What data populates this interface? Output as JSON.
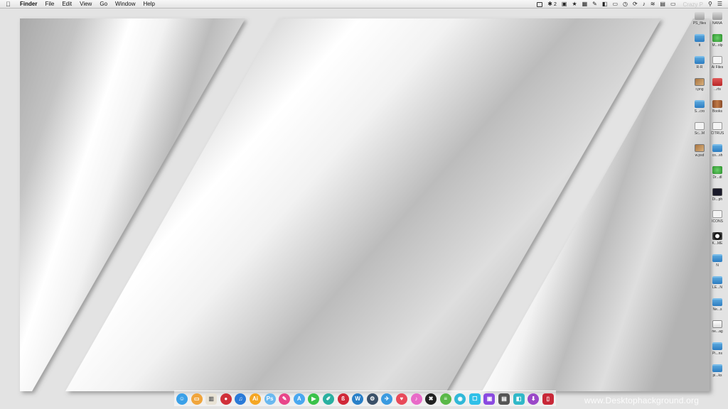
{
  "menubar": {
    "app_name": "Finder",
    "items": [
      "File",
      "Edit",
      "View",
      "Go",
      "Window",
      "Help"
    ],
    "status_count": "2",
    "user_name": "Crazy P"
  },
  "desktop_icons_left": [
    {
      "label": "PS_files",
      "kind": "disk"
    },
    {
      "label": "tt",
      "kind": "folder"
    },
    {
      "label": "R-R",
      "kind": "folder"
    },
    {
      "label": "r.png",
      "kind": "image"
    },
    {
      "label": "S...cro",
      "kind": "folder"
    },
    {
      "label": "Sc...M",
      "kind": "doc"
    },
    {
      "label": "w.psd",
      "kind": "image"
    }
  ],
  "desktop_icons_right": [
    {
      "label": "NANA",
      "kind": "disk"
    },
    {
      "label": "M...olp",
      "kind": "app"
    },
    {
      "label": "Ai Files",
      "kind": "doc"
    },
    {
      "label": "...rts",
      "kind": "reddoc"
    },
    {
      "label": "Books",
      "kind": "books"
    },
    {
      "label": "CITRUS",
      "kind": "doc"
    },
    {
      "label": "co...sh",
      "kind": "folder"
    },
    {
      "label": "Dr...dl",
      "kind": "app"
    },
    {
      "label": "Di...ph",
      "kind": "dark"
    },
    {
      "label": "ICONS",
      "kind": "doc"
    },
    {
      "label": "K...ME",
      "kind": "ring"
    },
    {
      "label": "N",
      "kind": "folder"
    },
    {
      "label": "LE...N",
      "kind": "folder"
    },
    {
      "label": "Ne...s",
      "kind": "folder"
    },
    {
      "label": "ne...ag",
      "kind": "bag"
    },
    {
      "label": "Pi...ns",
      "kind": "folder"
    },
    {
      "label": "pi...ks",
      "kind": "folder"
    }
  ],
  "dock": [
    {
      "name": "finder",
      "color": "#3aa0e8",
      "glyph": "☺"
    },
    {
      "name": "folder",
      "color": "#f0a53c",
      "glyph": "▭"
    },
    {
      "name": "book",
      "color": "#e8e2d4",
      "glyph": "▥"
    },
    {
      "name": "record",
      "color": "#d0303a",
      "glyph": "●"
    },
    {
      "name": "music",
      "color": "#2a7ad8",
      "glyph": "♫"
    },
    {
      "name": "illustrator",
      "color": "#f5a623",
      "glyph": "Ai"
    },
    {
      "name": "preview",
      "color": "#6ab9f0",
      "glyph": "Ps"
    },
    {
      "name": "paint",
      "color": "#e8468a",
      "glyph": "✎"
    },
    {
      "name": "appstore",
      "color": "#4aa8f0",
      "glyph": "A"
    },
    {
      "name": "facetime",
      "color": "#3ac24a",
      "glyph": "▶"
    },
    {
      "name": "pencil",
      "color": "#2ab0a0",
      "glyph": "✐"
    },
    {
      "name": "lastpass",
      "color": "#d02838",
      "glyph": "ß"
    },
    {
      "name": "wunderlist",
      "color": "#2a80c8",
      "glyph": "W"
    },
    {
      "name": "settings",
      "color": "#3a5068",
      "glyph": "⚙"
    },
    {
      "name": "bird",
      "color": "#3a9ae0",
      "glyph": "✈"
    },
    {
      "name": "pocket",
      "color": "#e84a5a",
      "glyph": "♥"
    },
    {
      "name": "itunes",
      "color": "#e86ac8",
      "glyph": "♪"
    },
    {
      "name": "nodes",
      "color": "#222222",
      "glyph": "✖"
    },
    {
      "name": "dashboard",
      "color": "#5ab848",
      "glyph": "≡"
    },
    {
      "name": "eye",
      "color": "#30b8d8",
      "glyph": "◉"
    },
    {
      "name": "notes",
      "color": "#30c0e8",
      "glyph": "☐"
    },
    {
      "name": "screen",
      "color": "#8a4ae0",
      "glyph": "▣"
    },
    {
      "name": "monitor",
      "color": "#555555",
      "glyph": "▤"
    },
    {
      "name": "maps",
      "color": "#30b8c8",
      "glyph": "◧"
    },
    {
      "name": "download",
      "color": "#9a48c8",
      "glyph": "⬇"
    },
    {
      "name": "trash",
      "color": "#c82838",
      "glyph": "▯"
    }
  ],
  "watermark": "www.Desktophackground.org"
}
